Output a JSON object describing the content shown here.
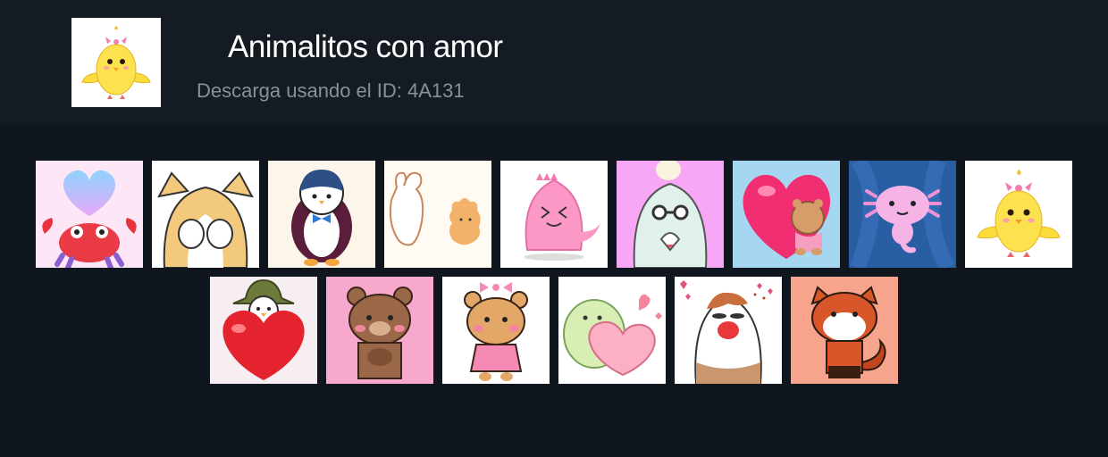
{
  "pack": {
    "title": "Animalitos con amor",
    "subtitle": "Descarga usando el ID: 4A131",
    "thumbnail_icon": "yellow-chick-icon"
  },
  "stickers": [
    {
      "icon": "blue-heart-red-crab-icon",
      "bg": "#fde6f6"
    },
    {
      "icon": "corgi-covering-face-icon",
      "bg": "#ffffff"
    },
    {
      "icon": "penguin-with-bowtie-icon",
      "bg": "#fbf5ea"
    },
    {
      "icon": "white-and-brown-bears-icon",
      "bg": "#fffaf2"
    },
    {
      "icon": "pink-dinosaur-icon",
      "bg": "#ffffff"
    },
    {
      "icon": "penguin-heart-hands-icon",
      "bg": "#f7a7f6"
    },
    {
      "icon": "bear-hugging-heart-icon",
      "bg": "#a5d6f2"
    },
    {
      "icon": "pink-axolotl-icon",
      "bg": "#2a5ea3"
    },
    {
      "icon": "yellow-chick-icon",
      "bg": "#ffffff"
    },
    {
      "icon": "penguin-hat-big-heart-icon",
      "bg": "#f7eef2"
    },
    {
      "icon": "brown-bear-pink-bg-icon",
      "bg": "#f6a9cc"
    },
    {
      "icon": "bear-with-bow-icon",
      "bg": "#ffffff"
    },
    {
      "icon": "green-blob-heart-icon",
      "bg": "#ffffff"
    },
    {
      "icon": "hamster-hearts-icon",
      "bg": "#ffffff"
    },
    {
      "icon": "red-panda-icon",
      "bg": "#f6a48c"
    }
  ]
}
